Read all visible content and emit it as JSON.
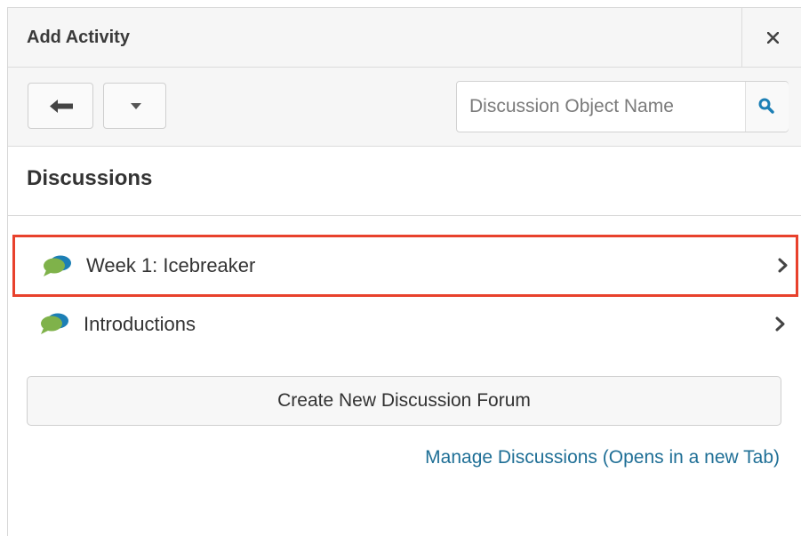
{
  "dialog": {
    "title": "Add Activity",
    "close_icon": "close-icon"
  },
  "toolbar": {
    "back_icon": "arrow-left-icon",
    "dropdown_icon": "caret-down-icon",
    "search": {
      "placeholder": "Discussion Object Name",
      "value": "",
      "icon": "search-icon"
    }
  },
  "section": {
    "title": "Discussions"
  },
  "items": [
    {
      "label": "Week 1: Icebreaker",
      "icon": "speech-bubbles-icon",
      "highlighted": true
    },
    {
      "label": "Introductions",
      "icon": "speech-bubbles-icon",
      "highlighted": false
    }
  ],
  "actions": {
    "create_label": "Create New Discussion Forum",
    "manage_label": "Manage Discussions (Opens in a new Tab)"
  },
  "colors": {
    "highlight_border": "#e8412c",
    "link": "#1f6f96",
    "accent_icon": "#1c7fb5"
  }
}
